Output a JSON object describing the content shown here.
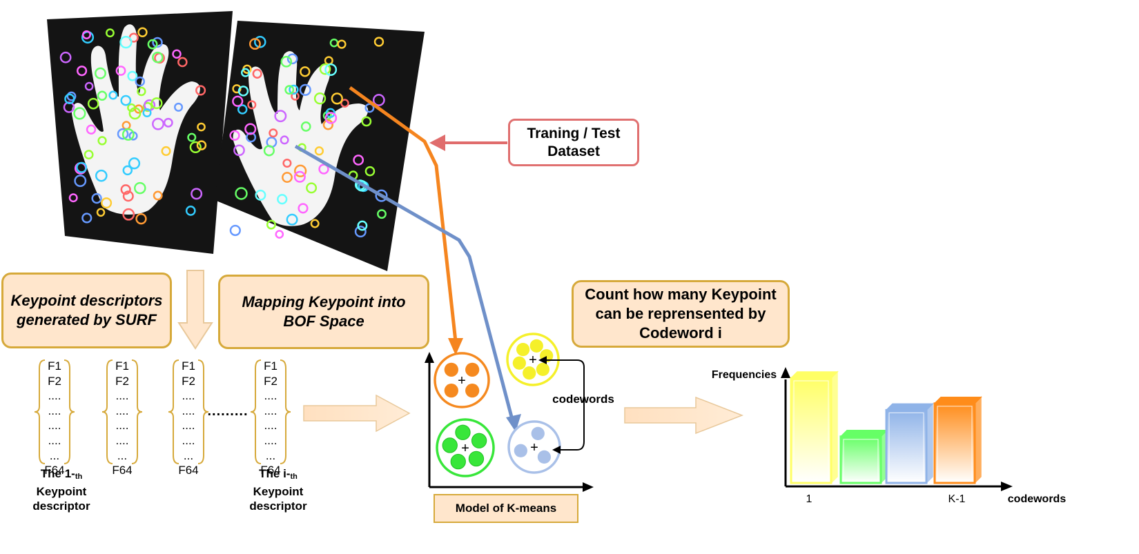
{
  "boxes": {
    "keypoint_descriptors": [
      "Keypoint descriptors",
      "generated by SURF"
    ],
    "mapping": [
      "Mapping Keypoint into",
      "BOF  Space"
    ],
    "count": [
      "Count how many Keypoint",
      "can be reprensented by",
      "Codeword i"
    ],
    "dataset": [
      "Traning / Test",
      "Dataset"
    ],
    "kmeans_model": "Model of K-means"
  },
  "descriptor_entries": [
    "F1",
    "F2",
    "....",
    "....",
    "....",
    "....",
    "...",
    "F64"
  ],
  "captions": {
    "first": {
      "line1_prefix": "The 1-",
      "line1_sub": "th",
      "line2": "Keypoint",
      "line3": "descriptor"
    },
    "ith": {
      "line1_prefix": "The  i-",
      "line1_sub": "th",
      "line2": "Keypoint",
      "line3": "descriptor"
    }
  },
  "ellipsis": ".........",
  "kmeans": {
    "codewords_label": "codewords",
    "clusters": [
      {
        "name": "orange",
        "color": "#f5891f",
        "points": 4
      },
      {
        "name": "yellow",
        "color": "#f5f02a",
        "points": 6
      },
      {
        "name": "green",
        "color": "#38e63a",
        "points": 5
      },
      {
        "name": "blue",
        "color": "#a9c0e8",
        "points": 3
      }
    ]
  },
  "chart_data": {
    "type": "bar",
    "ylabel": "Frequencies",
    "xlabel": "codewords",
    "tick_labels": [
      "1",
      "K-1"
    ],
    "bars": [
      {
        "color": "#ffff66",
        "value": 0.95
      },
      {
        "color": "#66ff66",
        "value": 0.42
      },
      {
        "color": "#8fb3e8",
        "value": 0.66
      },
      {
        "color": "#ff8c1a",
        "value": 0.72
      }
    ]
  },
  "colors": {
    "orange_arrow": "#f5851f",
    "blue_arrow": "#6f90c9",
    "red_arrow": "#e06c6c",
    "box_fill": "#ffe6cc",
    "box_border": "#d6a93a"
  }
}
